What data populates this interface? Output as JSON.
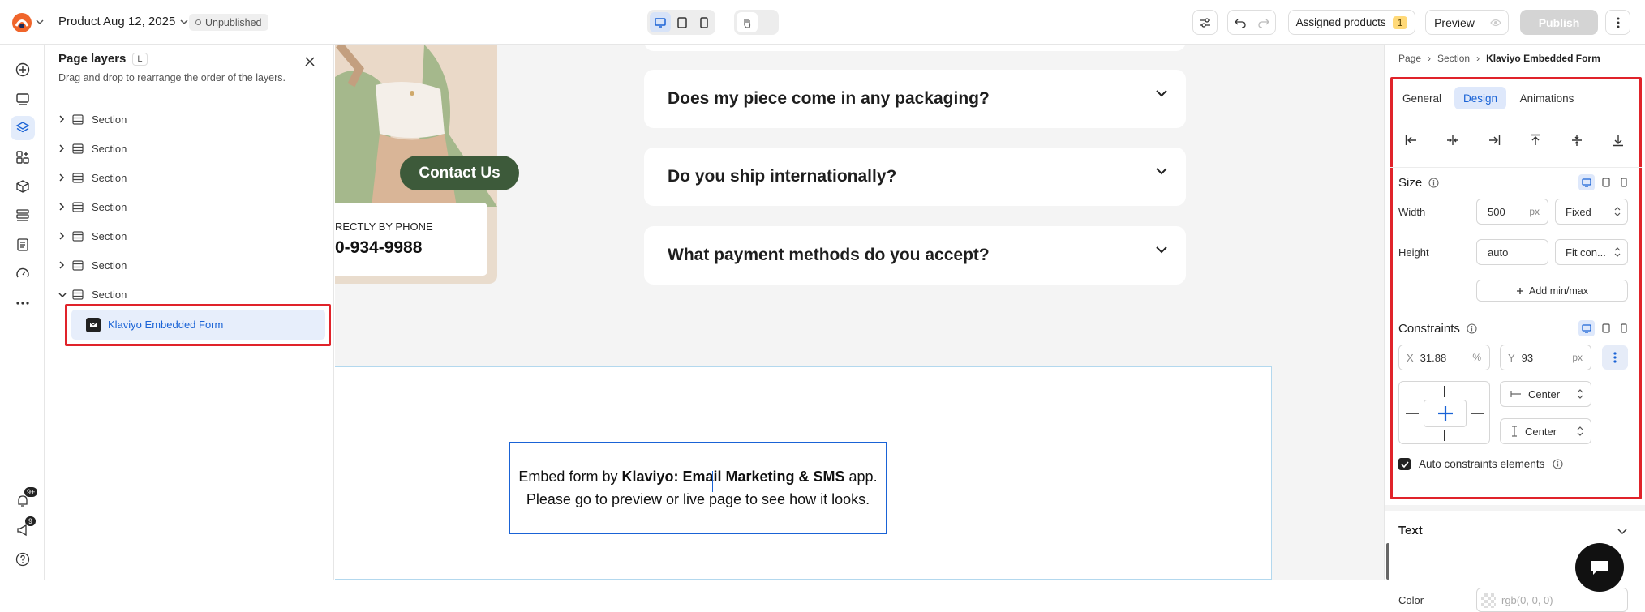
{
  "topbar": {
    "product_title": "Product Aug 12, 2025",
    "status": "Unpublished",
    "assigned_products_label": "Assigned products",
    "assigned_products_count": "1",
    "preview_label": "Preview",
    "publish_label": "Publish"
  },
  "rail": {
    "notifications_badge": "9+",
    "announcements_badge": "9"
  },
  "layers": {
    "title": "Page layers",
    "shortcut": "L",
    "subtitle": "Drag and drop to rearrange the order of the layers.",
    "items": [
      {
        "label": "Section"
      },
      {
        "label": "Section"
      },
      {
        "label": "Section"
      },
      {
        "label": "Section"
      },
      {
        "label": "Section"
      },
      {
        "label": "Section"
      },
      {
        "label": "Section"
      }
    ],
    "child_label": "Klaviyo Embedded Form"
  },
  "canvas": {
    "contact_button": "Contact Us",
    "phone_caption": "RECTLY BY PHONE",
    "phone_number": "0-934-9988",
    "faq": [
      {
        "question": "Does my piece come in any packaging?"
      },
      {
        "question": "Do you ship internationally?"
      },
      {
        "question": "What payment methods do you accept?"
      }
    ],
    "embed_prefix": "Embed form by ",
    "embed_app": "Klaviyo: Email Marketing & SMS",
    "embed_suffix": " app.",
    "embed_line2": "Please go to preview or live page to see how it looks."
  },
  "inspector": {
    "breadcrumb": [
      "Page",
      "Section",
      "Klaviyo Embedded Form"
    ],
    "tabs": [
      "General",
      "Design",
      "Animations"
    ],
    "active_tab": "Design",
    "size_label": "Size",
    "width_label": "Width",
    "width_value": "500",
    "width_unit": "px",
    "width_mode": "Fixed",
    "height_label": "Height",
    "height_value": "auto",
    "height_mode": "Fit con...",
    "add_minmax": "Add min/max",
    "constraints_label": "Constraints",
    "x_label": "X",
    "x_value": "31.88",
    "x_unit": "%",
    "y_label": "Y",
    "y_value": "93",
    "y_unit": "px",
    "h_align": "Center",
    "v_align": "Center",
    "auto_constraints": "Auto constraints elements",
    "text_section": "Text",
    "color_label": "Color",
    "color_value": "rgb(0, 0, 0)"
  },
  "colors": {
    "accent": "#1a63d6",
    "highlight": "#e0232a",
    "contact_button": "#3d5a3a",
    "selected_row": "#e7eefb"
  }
}
